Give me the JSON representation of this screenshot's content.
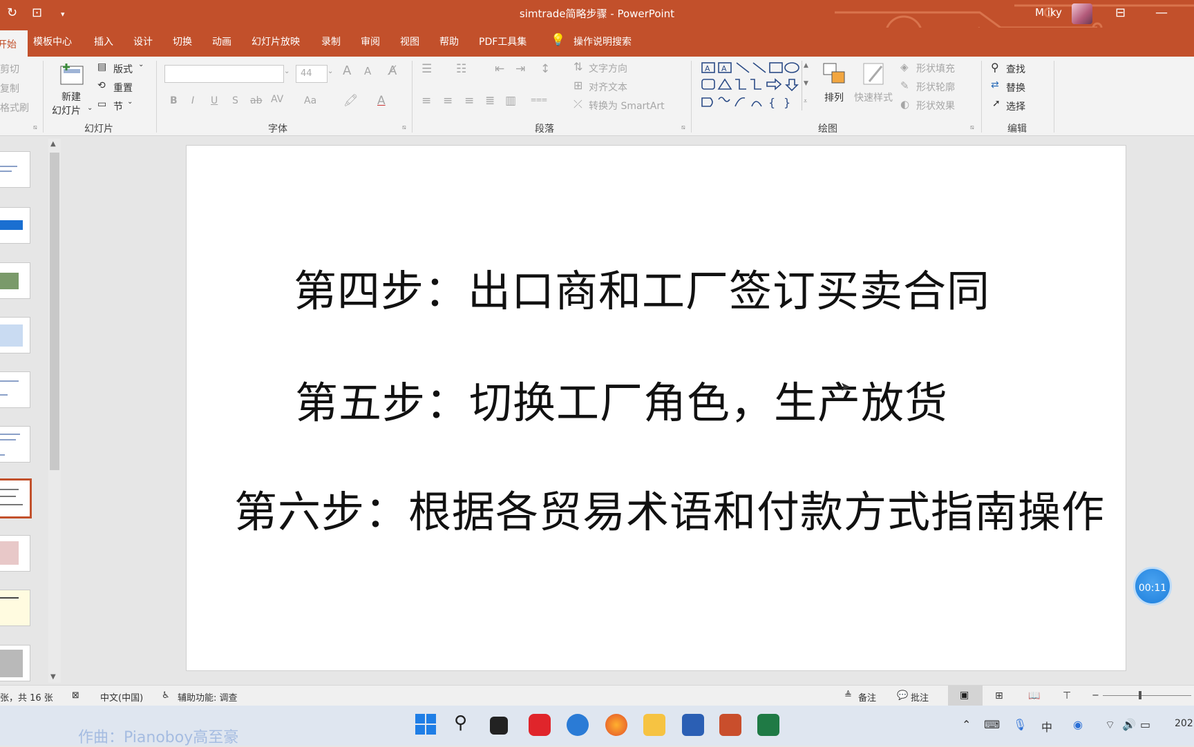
{
  "titlebar": {
    "title": "simtrade简略步骤  -  PowerPoint",
    "user": "M iky"
  },
  "tabs": [
    "开始",
    "模板中心",
    "插入",
    "设计",
    "切换",
    "动画",
    "幻灯片放映",
    "录制",
    "审阅",
    "视图",
    "帮助",
    "PDF工具集",
    "操作说明搜索"
  ],
  "ribbon": {
    "clipboard": {
      "cut": "剪切",
      "copy": "复制",
      "format_painter": "格式刷"
    },
    "slides": {
      "new_slide_line1": "新建",
      "new_slide_line2": "幻灯片",
      "layout": "版式",
      "reset": "重置",
      "section": "节",
      "group_label": "幻灯片"
    },
    "font": {
      "font_name": "",
      "font_size": "44",
      "group_label": "字体",
      "bold": "B",
      "italic": "I",
      "underline": "U",
      "shadow": "S",
      "strike": "ab",
      "spacing": "AV",
      "case": "Aa",
      "grow": "A",
      "shrink": "A",
      "color": "A"
    },
    "paragraph": {
      "text_direction": "文字方向",
      "align_text": "对齐文本",
      "smartart": "转换为 SmartArt",
      "group_label": "段落"
    },
    "drawing": {
      "arrange": "排列",
      "quick_styles": "快速样式",
      "shape_fill": "形状填充",
      "shape_outline": "形状轮廓",
      "shape_effects": "形状效果",
      "group_label": "绘图"
    },
    "editing": {
      "find": "查找",
      "replace": "替换",
      "select": "选择",
      "group_label": "编辑"
    }
  },
  "slide": {
    "step4": "第四步：出口商和工厂签订买卖合同",
    "step5": "第五步：切换工厂角色，生产放货",
    "step6": "第六步：根据各贸易术语和付款方式指南操作"
  },
  "timer": "00:11",
  "status": {
    "slide_count": "张，共 16 张",
    "language": "中文(中国)",
    "accessibility": "辅助功能: 调查",
    "notes": "备注",
    "comments": "批注"
  },
  "taskbar": {
    "clock_partial": "202"
  },
  "watermark": "作曲：Pianoboy高至豪",
  "colors": {
    "accent": "#c2502b",
    "ribbon_bg": "#f3f3f3",
    "workspace_bg": "#e6e6e6"
  }
}
